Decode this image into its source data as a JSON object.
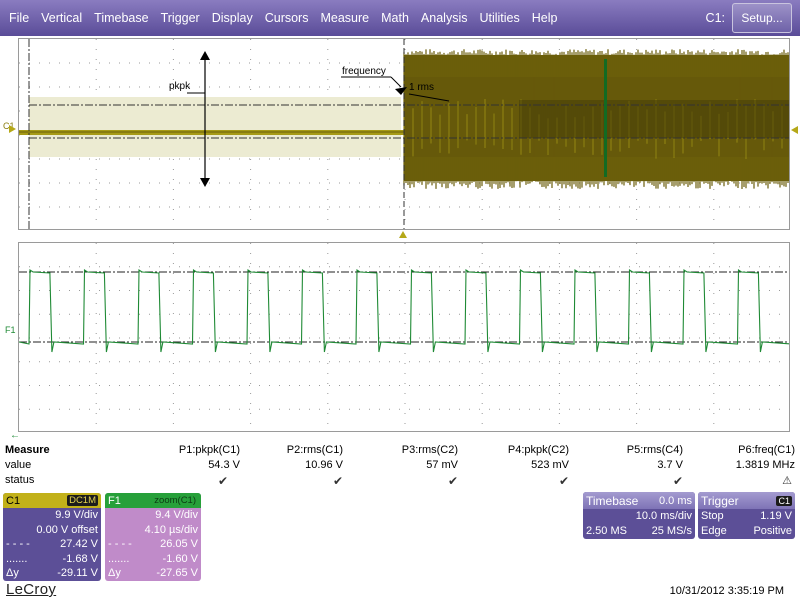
{
  "menu": {
    "items": [
      "File",
      "Vertical",
      "Timebase",
      "Trigger",
      "Display",
      "Cursors",
      "Measure",
      "Math",
      "Analysis",
      "Utilities",
      "Help"
    ],
    "channel_label": "C1:",
    "setup_label": "Setup..."
  },
  "traces": {
    "top_label": "C1",
    "bottom_label": "F1",
    "annotations": {
      "pkpk": "pkpk",
      "frequency": "frequency",
      "rms": "1 rms"
    },
    "colors": {
      "c1": "#b5a818",
      "c1_dark": "#6b5e0a",
      "f1": "#1f8a35",
      "grid": "#8c8c8c"
    }
  },
  "measure": {
    "title": "Measure",
    "row_labels": {
      "value": "value",
      "status": "status"
    },
    "params": [
      {
        "name": "P1:pkpk(C1)",
        "value": "54.3 V",
        "status": "check"
      },
      {
        "name": "P2:rms(C1)",
        "value": "10.96 V",
        "status": "check"
      },
      {
        "name": "P3:rms(C2)",
        "value": "57 mV",
        "status": "check"
      },
      {
        "name": "P4:pkpk(C2)",
        "value": "523 mV",
        "status": "check"
      },
      {
        "name": "P5:rms(C4)",
        "value": "3.7 V",
        "status": "check"
      },
      {
        "name": "P6:freq(C1)",
        "value": "1.3819 MHz",
        "status": "warning"
      }
    ]
  },
  "panel_c1": {
    "name": "C1",
    "badge": "DC1M",
    "vdiv": "9.9 V/div",
    "offset": "0.00 V offset",
    "cursor1": "27.42 V",
    "cursor2": "-1.68 V",
    "dy_label": "Δy",
    "dy": "-29.11 V"
  },
  "panel_f1": {
    "name": "F1",
    "badge": "zoom(C1)",
    "vdiv": "9.4 V/div",
    "tdiv": "4.10 µs/div",
    "cursor1": "26.05 V",
    "cursor2": "-1.60 V",
    "dy_label": "Δy",
    "dy": "-27.65 V"
  },
  "timebase": {
    "title": "Timebase",
    "delay": "0.0 ms",
    "tdiv": "10.0 ms/div",
    "samples": "2.50 MS",
    "rate": "25 MS/s"
  },
  "trigger": {
    "title": "Trigger",
    "badge": "C1",
    "mode": "Stop",
    "level": "1.19 V",
    "type": "Edge",
    "slope": "Positive"
  },
  "brand": "LeCroy",
  "timestamp": "10/31/2012 3:35:19 PM"
}
